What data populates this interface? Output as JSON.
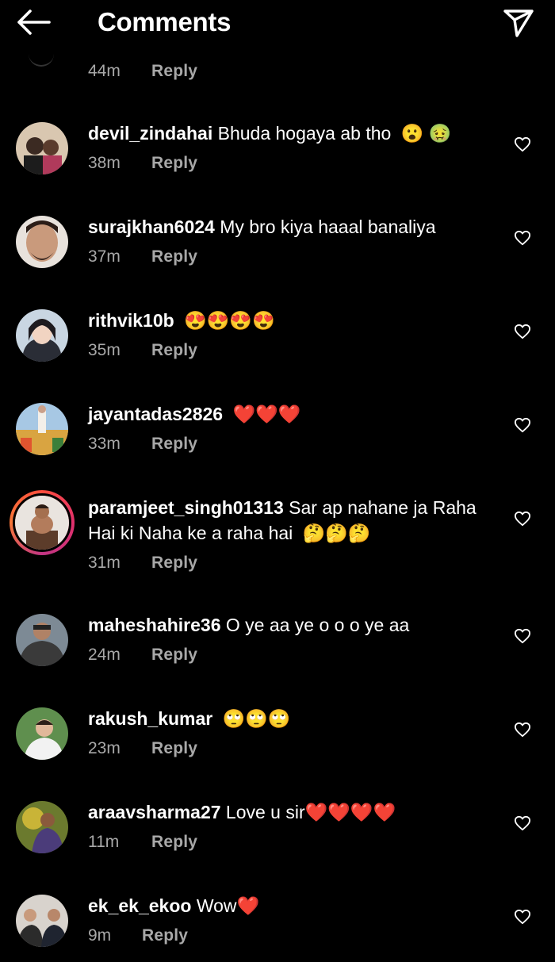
{
  "header": {
    "title": "Comments",
    "back_icon": "arrow-left-icon",
    "share_icon": "paper-plane-icon"
  },
  "top_partial": {
    "time": "44m",
    "reply_label": "Reply"
  },
  "colors": {
    "background": "#000000",
    "text_primary": "#ffffff",
    "text_secondary": "#a8a8a8",
    "story_ring": "#e1306c"
  },
  "comments": [
    {
      "username": "devil_zindahai",
      "text": "Bhuda  hogaya ab tho",
      "emojis": "😮 🤢",
      "time": "38m",
      "reply_label": "Reply"
    },
    {
      "username": "surajkhan6024",
      "text": "My bro kiya haaal banaliya",
      "emojis": "",
      "time": "37m",
      "reply_label": "Reply"
    },
    {
      "username": "rithvik10b",
      "text": "",
      "emojis": "😍😍😍😍",
      "time": "35m",
      "reply_label": "Reply"
    },
    {
      "username": "jayantadas2826",
      "text": "",
      "emojis": "❤️❤️❤️",
      "time": "33m",
      "reply_label": "Reply"
    },
    {
      "username": "paramjeet_singh01313",
      "text": "Sar ap nahane ja Raha Hai ki Naha ke a raha hai",
      "emojis": "🤔🤔🤔",
      "time": "31m",
      "reply_label": "Reply",
      "has_story": true
    },
    {
      "username": "maheshahire36",
      "text": "O ye aa ye o o o ye aa",
      "emojis": "",
      "time": "24m",
      "reply_label": "Reply"
    },
    {
      "username": "rakush_kumar",
      "text": "",
      "emojis": "🙄🙄🙄",
      "time": "23m",
      "reply_label": "Reply"
    },
    {
      "username": "araavsharma27",
      "text": "Love u sir",
      "emojis": "❤️❤️❤️❤️",
      "time": "11m",
      "reply_label": "Reply"
    },
    {
      "username": "ek_ek_ekoo",
      "text": "Wow",
      "emojis": "❤️",
      "time": "9m",
      "reply_label": "Reply"
    }
  ]
}
